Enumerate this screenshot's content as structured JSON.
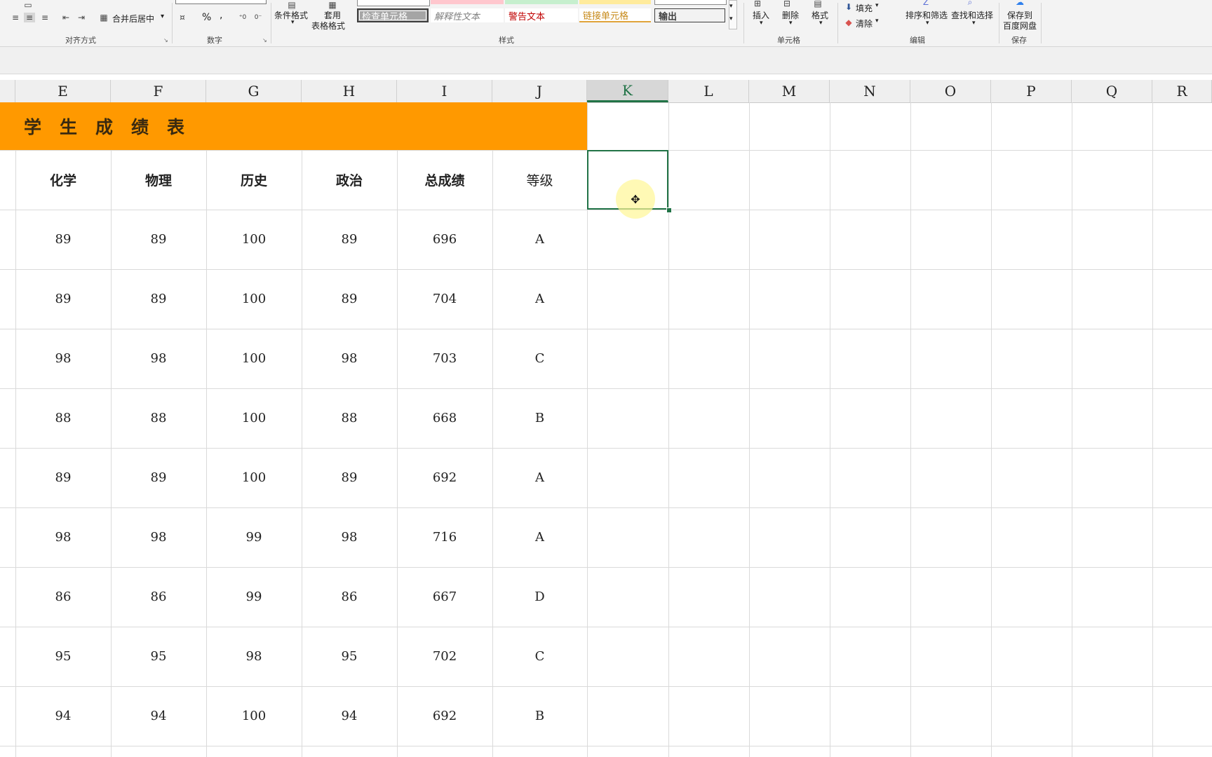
{
  "ribbon": {
    "alignment": {
      "group_label": "对齐方式",
      "merge_center": "合并后居中"
    },
    "number": {
      "group_label": "数字",
      "percent": "%",
      "comma": ","
    },
    "styles": {
      "group_label": "样式",
      "conditional_format": "条件格式",
      "table_format_line1": "套用",
      "table_format_line2": "表格格式",
      "tiles": [
        {
          "label": "检查单元格",
          "bg": "#a5a5a5",
          "color": "#ffffff"
        },
        {
          "label": "解释性文本",
          "bg": "#ffffff",
          "color": "#7f7f7f"
        },
        {
          "label": "警告文本",
          "bg": "#ffffff",
          "color": "#c00000"
        },
        {
          "label": "链接单元格",
          "bg": "#ffffff",
          "color": "#c78a1a"
        },
        {
          "label": "输出",
          "bg": "#f2f2f2",
          "color": "#3f3f3f"
        }
      ]
    },
    "cells": {
      "group_label": "单元格",
      "insert": "插入",
      "delete": "删除",
      "format": "格式"
    },
    "editing": {
      "group_label": "编辑",
      "fill": "填充",
      "clear": "清除",
      "sort_filter": "排序和筛选",
      "find_select": "查找和选择"
    },
    "save": {
      "group_label": "保存",
      "line1": "保存到",
      "line2": "百度网盘"
    }
  },
  "columns": [
    {
      "label": "E"
    },
    {
      "label": "F"
    },
    {
      "label": "G"
    },
    {
      "label": "H"
    },
    {
      "label": "I"
    },
    {
      "label": "J"
    },
    {
      "label": "K",
      "active": true
    },
    {
      "label": "L"
    },
    {
      "label": "M"
    },
    {
      "label": "N"
    },
    {
      "label": "O"
    },
    {
      "label": "P"
    },
    {
      "label": "Q"
    },
    {
      "label": "R"
    }
  ],
  "sheet": {
    "title": "学生成绩表",
    "title_color": "#ff9900",
    "headers": [
      "化学",
      "物理",
      "历史",
      "政治",
      "总成绩",
      "等级"
    ],
    "rows": [
      [
        "89",
        "89",
        "100",
        "89",
        "696",
        "A"
      ],
      [
        "89",
        "89",
        "100",
        "89",
        "704",
        "A"
      ],
      [
        "98",
        "98",
        "100",
        "98",
        "703",
        "C"
      ],
      [
        "88",
        "88",
        "100",
        "88",
        "668",
        "B"
      ],
      [
        "89",
        "89",
        "100",
        "89",
        "692",
        "A"
      ],
      [
        "98",
        "98",
        "99",
        "98",
        "716",
        "A"
      ],
      [
        "86",
        "86",
        "99",
        "86",
        "667",
        "D"
      ],
      [
        "95",
        "95",
        "98",
        "95",
        "702",
        "C"
      ],
      [
        "94",
        "94",
        "100",
        "94",
        "692",
        "B"
      ]
    ]
  },
  "selection": {
    "cell": "K",
    "accent": "#217346"
  }
}
